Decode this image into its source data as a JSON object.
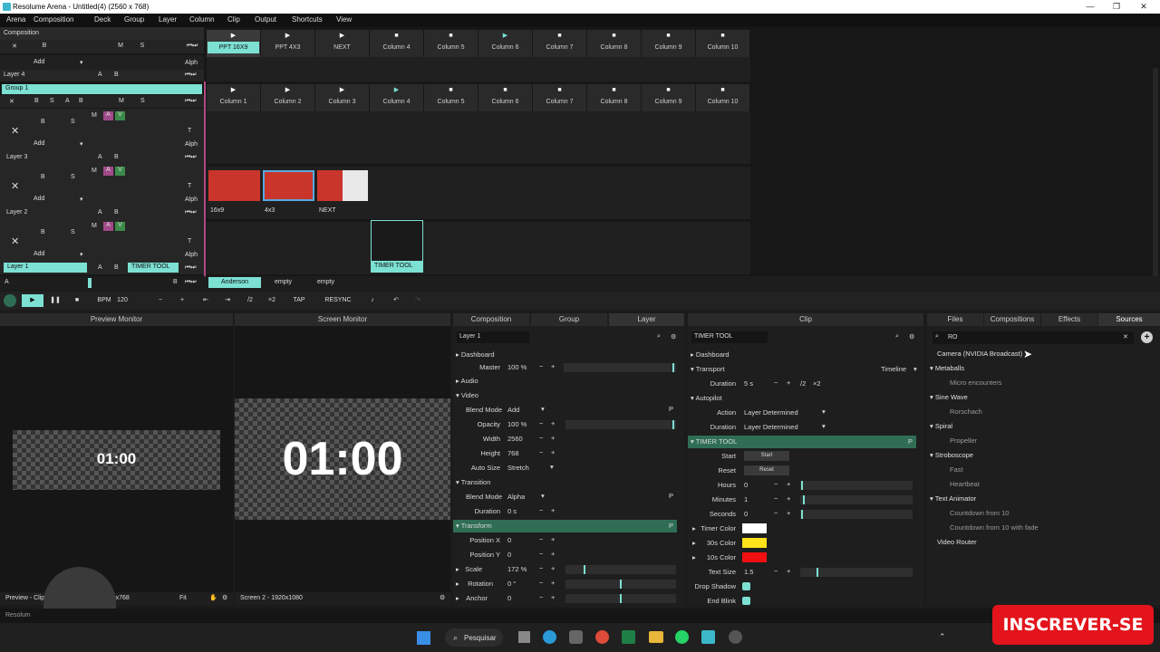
{
  "window": {
    "title": "Resolume Arena - Untitled(4) (2560 x 768)",
    "min": "—",
    "max": "❐",
    "close": "✕"
  },
  "menu": [
    "Arena",
    "Composition",
    "Deck",
    "Group",
    "Layer",
    "Column",
    "Clip",
    "Output",
    "Shortcuts",
    "View"
  ],
  "composition": {
    "label": "Composition",
    "add": "Add",
    "alph": "Alph",
    "columns": [
      "PPT 16X9",
      "PPT 4X3",
      "NEXT",
      "Column 4",
      "Column 5",
      "Column 6",
      "Column 7",
      "Column 8",
      "Column 9",
      "Column 10"
    ]
  },
  "layer4": {
    "label": "Layer 4",
    "a": "A",
    "b": "B"
  },
  "group": {
    "label": "Group 1",
    "columns": [
      "Column 1",
      "Column 2",
      "Column 3",
      "Column 4",
      "Column 5",
      "Column 6",
      "Column 7",
      "Column 8",
      "Column 9",
      "Column 10"
    ]
  },
  "layers": [
    {
      "label": "Layer 3",
      "add": "Add",
      "clips": []
    },
    {
      "label": "Layer 2",
      "add": "Add",
      "clips": [
        "16x9",
        "4x3",
        "NEXT"
      ]
    },
    {
      "label": "Layer 1",
      "add": "Add",
      "clipname": "TIMER TOOL",
      "clips": [
        "TIMER TOOL"
      ]
    }
  ],
  "common": {
    "x": "✕",
    "b": "B",
    "s": "S",
    "m": "M",
    "a": "A",
    "v": "V",
    "t": "T",
    "alph": "Alph"
  },
  "decks": [
    "Anderson",
    "empty",
    "empty"
  ],
  "deckbar": {
    "a": "A",
    "b": "B"
  },
  "transport": {
    "bpm_label": "BPM",
    "bpm": "120",
    "minus": "−",
    "plus": "+",
    "half": "/2",
    "double": "×2",
    "tap": "TAP",
    "resync": "RESYNC"
  },
  "preview": {
    "title": "Preview Monitor",
    "time": "01:00",
    "footer": "Preview - Clip",
    "res": "2560x768",
    "fit": "Fit"
  },
  "screen": {
    "title": "Screen Monitor",
    "time": "01:00",
    "footer": "Screen 2 - 1920x1080"
  },
  "layerpanel": {
    "tabs": [
      "Composition",
      "Group",
      "Layer"
    ],
    "name": "Layer 1",
    "dashboard": "Dashboard",
    "master_label": "Master",
    "master": "100 %",
    "audio": "Audio",
    "video": "Video",
    "blend_label": "Blend Mode",
    "blend": "Add",
    "opacity_label": "Opacity",
    "opacity": "100 %",
    "width_label": "Width",
    "width": "2560",
    "height_label": "Height",
    "height": "768",
    "autosize_label": "Auto Size",
    "autosize": "Stretch",
    "transition": "Transition",
    "tblend_label": "Blend Mode",
    "tblend": "Alpha",
    "duration_label": "Duration",
    "duration": "0 s",
    "transform": "Transform",
    "posx_label": "Position X",
    "posx": "0",
    "posy_label": "Position Y",
    "posy": "0",
    "scale_label": "Scale",
    "scale": "172 %",
    "rotation_label": "Rotation",
    "rotation": "0 °",
    "anchor_label": "Anchor",
    "anchor": "0",
    "p": "P"
  },
  "clippanel": {
    "title": "Clip",
    "name": "TIMER TOOL",
    "dashboard": "Dashboard",
    "transport": "Transport",
    "timeline": "Timeline",
    "duration_label": "Duration",
    "duration": "5 s",
    "half": "/2",
    "double": "×2",
    "autopilot": "Autopilot",
    "action_label": "Action",
    "action": "Layer Determined",
    "duration2_label": "Duration",
    "duration2": "Layer Determined",
    "timertool": "TIMER TOOL",
    "start_label": "Start",
    "start": "Start",
    "reset_label": "Reset",
    "reset": "Reset",
    "hours_label": "Hours",
    "hours": "0",
    "minutes_label": "Minutes",
    "minutes": "1",
    "seconds_label": "Seconds",
    "seconds": "0",
    "timercolor_label": "Timer Color",
    "timercolor": "#ffffff",
    "color30_label": "30s Color",
    "color30": "#ffe21a",
    "color10_label": "10s Color",
    "color10": "#f01010",
    "textsize_label": "Text Size",
    "textsize": "1.5",
    "dropshadow_label": "Drop Shadow",
    "endblink_label": "End Blink",
    "p": "P"
  },
  "browser": {
    "tabs": [
      "Files",
      "Compositions",
      "Effects",
      "Sources"
    ],
    "search": "RO",
    "items": [
      {
        "text": "Camera (NVIDIA Broadcast)",
        "level": 0,
        "arrow": ""
      },
      {
        "text": "Metaballs",
        "level": 0,
        "arrow": "▾"
      },
      {
        "text": "Micro encounters",
        "level": 1,
        "arrow": ""
      },
      {
        "text": "Sine Wave",
        "level": 0,
        "arrow": "▾"
      },
      {
        "text": "Rorschach",
        "level": 1,
        "arrow": ""
      },
      {
        "text": "Spiral",
        "level": 0,
        "arrow": "▾"
      },
      {
        "text": "Propeller",
        "level": 1,
        "arrow": ""
      },
      {
        "text": "Stroboscope",
        "level": 0,
        "arrow": "▾"
      },
      {
        "text": "Fast",
        "level": 1,
        "arrow": ""
      },
      {
        "text": "Heartbeat",
        "level": 1,
        "arrow": ""
      },
      {
        "text": "Text Animator",
        "level": 0,
        "arrow": "▾"
      },
      {
        "text": "Countdown from 10",
        "level": 1,
        "arrow": ""
      },
      {
        "text": "Countdown from 10 with fade",
        "level": 1,
        "arrow": ""
      },
      {
        "text": "Video Router",
        "level": 0,
        "arrow": ""
      }
    ]
  },
  "statusbar": {
    "text": "Resolum"
  },
  "taskbar": {
    "search": "Pesquisar"
  },
  "overlay": {
    "subscribe": "INSCREVER-SE"
  },
  "colors": {
    "accent": "#7ce0d3",
    "green": "#2f6e55",
    "subscribe": "#e3141c"
  }
}
